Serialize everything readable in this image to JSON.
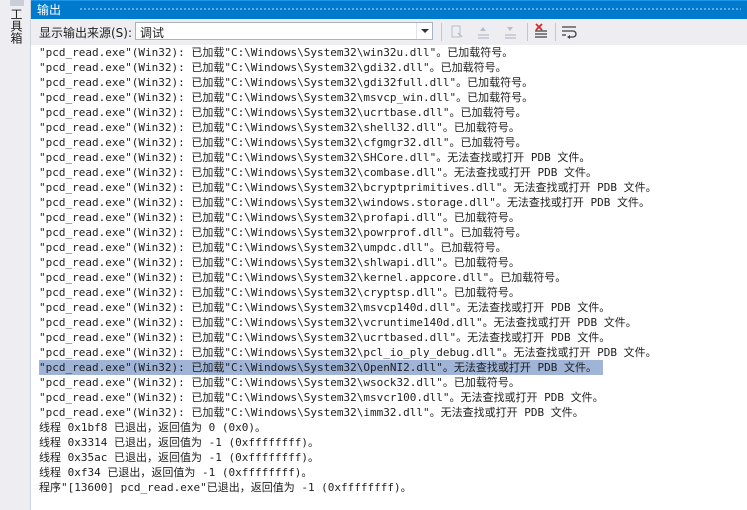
{
  "side_panel": {
    "toolbox_label": "工具箱"
  },
  "window": {
    "title": "输出"
  },
  "toolbar": {
    "source_label": "显示输出来源(S):",
    "source_value": "调试"
  },
  "output_lines": [
    "\"pcd_read.exe\"(Win32): 已加载\"C:\\Windows\\System32\\win32u.dll\"。已加载符号。",
    "\"pcd_read.exe\"(Win32): 已加载\"C:\\Windows\\System32\\gdi32.dll\"。已加载符号。",
    "\"pcd_read.exe\"(Win32): 已加载\"C:\\Windows\\System32\\gdi32full.dll\"。已加载符号。",
    "\"pcd_read.exe\"(Win32): 已加载\"C:\\Windows\\System32\\msvcp_win.dll\"。已加载符号。",
    "\"pcd_read.exe\"(Win32): 已加载\"C:\\Windows\\System32\\ucrtbase.dll\"。已加载符号。",
    "\"pcd_read.exe\"(Win32): 已加载\"C:\\Windows\\System32\\shell32.dll\"。已加载符号。",
    "\"pcd_read.exe\"(Win32): 已加载\"C:\\Windows\\System32\\cfgmgr32.dll\"。已加载符号。",
    "\"pcd_read.exe\"(Win32): 已加载\"C:\\Windows\\System32\\SHCore.dll\"。无法查找或打开 PDB 文件。",
    "\"pcd_read.exe\"(Win32): 已加载\"C:\\Windows\\System32\\combase.dll\"。无法查找或打开 PDB 文件。",
    "\"pcd_read.exe\"(Win32): 已加载\"C:\\Windows\\System32\\bcryptprimitives.dll\"。无法查找或打开 PDB 文件。",
    "\"pcd_read.exe\"(Win32): 已加载\"C:\\Windows\\System32\\windows.storage.dll\"。无法查找或打开 PDB 文件。",
    "\"pcd_read.exe\"(Win32): 已加载\"C:\\Windows\\System32\\profapi.dll\"。已加载符号。",
    "\"pcd_read.exe\"(Win32): 已加载\"C:\\Windows\\System32\\powrprof.dll\"。已加载符号。",
    "\"pcd_read.exe\"(Win32): 已加载\"C:\\Windows\\System32\\umpdc.dll\"。已加载符号。",
    "\"pcd_read.exe\"(Win32): 已加载\"C:\\Windows\\System32\\shlwapi.dll\"。已加载符号。",
    "\"pcd_read.exe\"(Win32): 已加载\"C:\\Windows\\System32\\kernel.appcore.dll\"。已加载符号。",
    "\"pcd_read.exe\"(Win32): 已加载\"C:\\Windows\\System32\\cryptsp.dll\"。已加载符号。",
    "\"pcd_read.exe\"(Win32): 已加载\"C:\\Windows\\System32\\msvcp140d.dll\"。无法查找或打开 PDB 文件。",
    "\"pcd_read.exe\"(Win32): 已加载\"C:\\Windows\\System32\\vcruntime140d.dll\"。无法查找或打开 PDB 文件。",
    "\"pcd_read.exe\"(Win32): 已加载\"C:\\Windows\\System32\\ucrtbased.dll\"。无法查找或打开 PDB 文件。",
    "\"pcd_read.exe\"(Win32): 已加载\"C:\\Windows\\System32\\pcl_io_ply_debug.dll\"。无法查找或打开 PDB 文件。",
    "\"pcd_read.exe\"(Win32): 已加载\"C:\\Windows\\System32\\OpenNI2.dll\"。无法查找或打开 PDB 文件。",
    "\"pcd_read.exe\"(Win32): 已加载\"C:\\Windows\\System32\\wsock32.dll\"。已加载符号。",
    "\"pcd_read.exe\"(Win32): 已加载\"C:\\Windows\\System32\\msvcr100.dll\"。无法查找或打开 PDB 文件。",
    "\"pcd_read.exe\"(Win32): 已加载\"C:\\Windows\\System32\\imm32.dll\"。无法查找或打开 PDB 文件。",
    "线程 0x1bf8 已退出，返回值为 0 (0x0)。",
    "线程 0x3314 已退出，返回值为 -1 (0xffffffff)。",
    "线程 0x35ac 已退出，返回值为 -1 (0xffffffff)。",
    "线程 0xf34 已退出，返回值为 -1 (0xffffffff)。",
    "程序\"[13600] pcd_read.exe\"已退出，返回值为 -1 (0xffffffff)。"
  ],
  "selected_line": 21,
  "colors": {
    "title_bar": "#007acc",
    "toolbar_bg": "#eeeef2",
    "selection": "#9fb4d6",
    "text": "#1e1e1e"
  },
  "icons": [
    "find-message-icon",
    "prev-message-icon",
    "next-message-icon",
    "clear-all-icon",
    "word-wrap-icon"
  ]
}
